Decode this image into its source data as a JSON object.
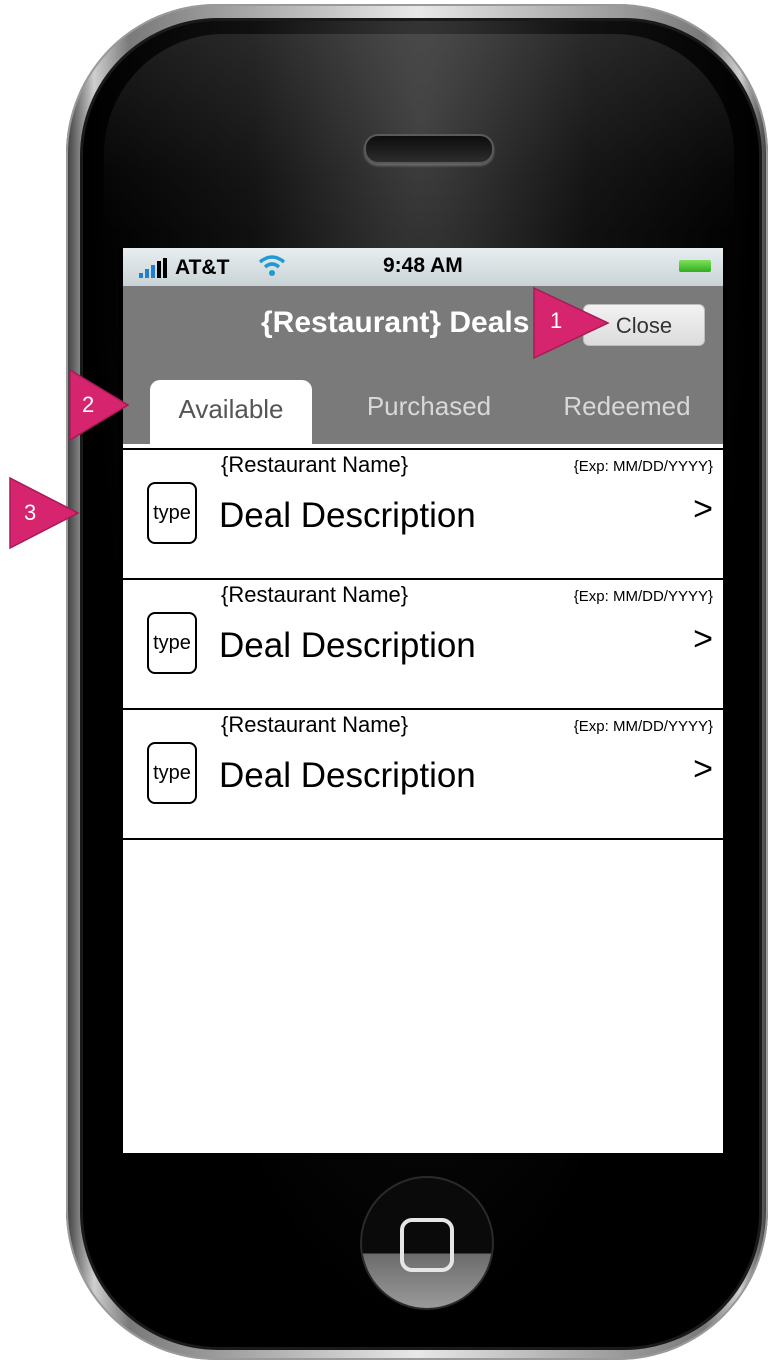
{
  "status_bar": {
    "carrier": "AT&T",
    "time": "9:48 AM"
  },
  "nav_bar": {
    "title": "{Restaurant} Deals",
    "close_label": "Close"
  },
  "tabs": [
    {
      "label": "Available",
      "active": true
    },
    {
      "label": "Purchased",
      "active": false
    },
    {
      "label": "Redeemed",
      "active": false
    }
  ],
  "deals": [
    {
      "restaurant": "{Restaurant Name}",
      "expiry": "{Exp: MM/DD/YYYY}",
      "type": "type",
      "description": "Deal Description",
      "chevron": ">"
    },
    {
      "restaurant": "{Restaurant Name}",
      "expiry": "{Exp: MM/DD/YYYY}",
      "type": "type",
      "description": "Deal Description",
      "chevron": ">"
    },
    {
      "restaurant": "{Restaurant Name}",
      "expiry": "{Exp: MM/DD/YYYY}",
      "type": "type",
      "description": "Deal Description",
      "chevron": ">"
    }
  ],
  "callouts": [
    "1",
    "2",
    "3"
  ],
  "colors": {
    "callout": "#d6246e",
    "nav_bar": "#7a7a7a",
    "tab_inactive_text": "#d8d8d8"
  }
}
